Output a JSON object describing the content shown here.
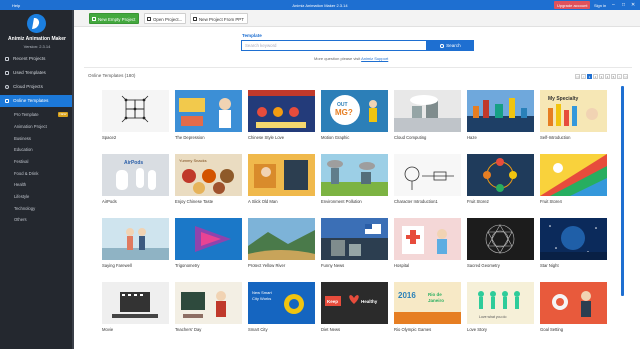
{
  "titlebar": {
    "help": "Help",
    "title": "Animiz Animation Maker 2.3.14",
    "upgrade": "Upgrade account",
    "signin": "Sign in",
    "minimize": "–",
    "maximize": "□",
    "close": "✕"
  },
  "sidebar": {
    "brand": "Animiz Animation Maker",
    "version": "Version: 2.3.14",
    "nav": [
      {
        "label": "Recent Projects"
      },
      {
        "label": "Used Templates"
      },
      {
        "label": "Cloud Projects"
      },
      {
        "label": "Online Templates"
      }
    ],
    "sub": [
      {
        "label": "Pro Template"
      },
      {
        "label": "Animation Project"
      },
      {
        "label": "Business"
      },
      {
        "label": "Education"
      },
      {
        "label": "Festival"
      },
      {
        "label": "Food & Drink"
      },
      {
        "label": "Health"
      },
      {
        "label": "Lifestyle"
      },
      {
        "label": "Technology"
      },
      {
        "label": "Others"
      }
    ],
    "badge": "NEW"
  },
  "toolbar": {
    "new_empty": "New Empty Project",
    "open": "Open Project...",
    "new_ppt": "New Project From PPT"
  },
  "search": {
    "label": "Template",
    "placeholder": "Search keyword",
    "button": "Search",
    "more_text": "More question please visit",
    "more_link": "Animiz Support"
  },
  "templates": {
    "heading": "Online Templates (180)",
    "pages": [
      "<<",
      "<",
      "1",
      "2",
      "3",
      "4",
      "5",
      ">",
      ">>"
    ],
    "items": [
      {
        "name": "Space2"
      },
      {
        "name": "The Depression"
      },
      {
        "name": "Chinese Style Love"
      },
      {
        "name": "Motion Graphic"
      },
      {
        "name": "Cloud Computing"
      },
      {
        "name": "Haze"
      },
      {
        "name": "Self-Introduction"
      },
      {
        "name": "AirPods"
      },
      {
        "name": "Enjoy Chinese Taste"
      },
      {
        "name": "A Slick Old Man"
      },
      {
        "name": "Environment Pollution"
      },
      {
        "name": "Character Introduction1"
      },
      {
        "name": "Fruit Store2"
      },
      {
        "name": "Fruit Store4"
      },
      {
        "name": "Saying Farewell"
      },
      {
        "name": "Trigonometry"
      },
      {
        "name": "Protect Yellow River"
      },
      {
        "name": "Funny News"
      },
      {
        "name": "Hospital"
      },
      {
        "name": "Sacred Geometry"
      },
      {
        "name": "Star Night"
      },
      {
        "name": "Movie"
      },
      {
        "name": "Teachers' Day"
      },
      {
        "name": "Smart City"
      },
      {
        "name": "Diet News"
      },
      {
        "name": "Rio Olympic Games"
      },
      {
        "name": "Love Story"
      },
      {
        "name": "Goal Setting"
      }
    ],
    "thumb_text": {
      "mg": "OUT\nMG?\nWhat is",
      "airpods": "AirPods",
      "yummy": "Yummy Snacks",
      "specialty": "My Specialty",
      "smartcity": "New Smart City Works",
      "keep": "Keep",
      "healthy": "Healthy",
      "rio": "2016",
      "rio2": "Rio de Janeiro",
      "love": "Love what you do"
    }
  },
  "colors": {
    "accent": "#1e6fd1",
    "sidebar_bg": "#24282f",
    "active_nav": "#1c79d9",
    "upgrade": "#e0525c",
    "green_button": "#43a83e"
  }
}
